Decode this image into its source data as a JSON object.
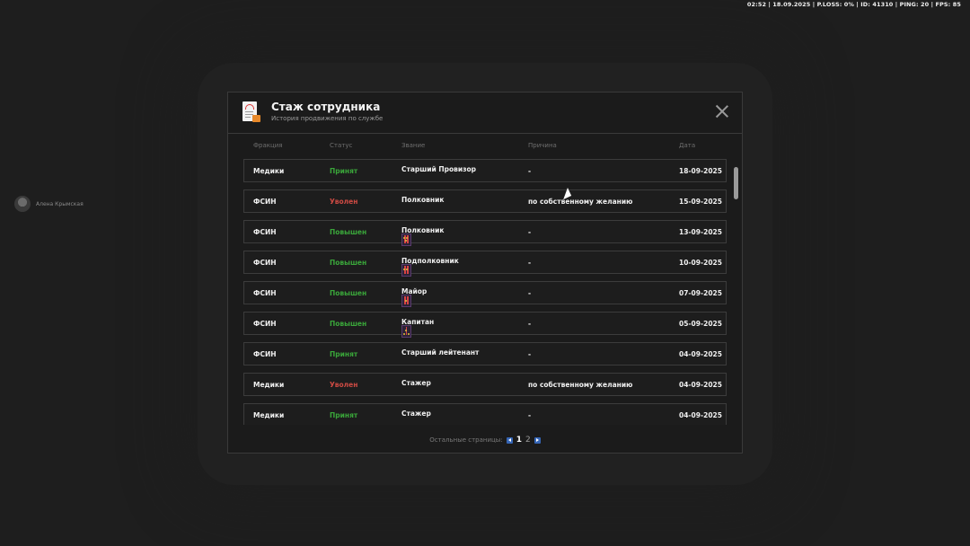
{
  "hud": {
    "text": "02:52 | 18.09.2025 | P.LOSS: 0% | ID: 41310 | PING: 20 | FPS: 85"
  },
  "player": {
    "name": "Алена Крымская"
  },
  "modal": {
    "title": "Стаж сотрудника",
    "subtitle": "История продвижения по службе",
    "columns": {
      "faction": "Фракция",
      "status": "Статус",
      "rank": "Звание",
      "reason": "Причина",
      "date": "Дата"
    },
    "rows": [
      {
        "faction": "Медики",
        "status": "Принят",
        "status_color": "green",
        "rank": "Старший Провизор",
        "rank_icon": "",
        "reason": "-",
        "date": "18-09-2025"
      },
      {
        "faction": "ФСИН",
        "status": "Уволен",
        "status_color": "red",
        "rank": "Полковник",
        "rank_icon": "",
        "reason": "по собственному желанию",
        "date": "15-09-2025"
      },
      {
        "faction": "ФСИН",
        "status": "Повышен",
        "status_color": "green",
        "rank": "Полковник",
        "rank_icon": "colonel-shoulder-strap-icon",
        "reason": "-",
        "date": "13-09-2025"
      },
      {
        "faction": "ФСИН",
        "status": "Повышен",
        "status_color": "green",
        "rank": "Подполковник",
        "rank_icon": "lieutenant-colonel-shoulder-strap-icon",
        "reason": "-",
        "date": "10-09-2025"
      },
      {
        "faction": "ФСИН",
        "status": "Повышен",
        "status_color": "green",
        "rank": "Майор",
        "rank_icon": "major-shoulder-strap-icon",
        "reason": "-",
        "date": "07-09-2025"
      },
      {
        "faction": "ФСИН",
        "status": "Повышен",
        "status_color": "green",
        "rank": "Капитан",
        "rank_icon": "captain-shoulder-strap-icon",
        "reason": "-",
        "date": "05-09-2025"
      },
      {
        "faction": "ФСИН",
        "status": "Принят",
        "status_color": "green",
        "rank": "Старший лейтенант",
        "rank_icon": "",
        "reason": "-",
        "date": "04-09-2025"
      },
      {
        "faction": "Медики",
        "status": "Уволен",
        "status_color": "red",
        "rank": "Стажер",
        "rank_icon": "",
        "reason": "по собственному желанию",
        "date": "04-09-2025"
      },
      {
        "faction": "Медики",
        "status": "Принят",
        "status_color": "green",
        "rank": "Стажер",
        "rank_icon": "",
        "reason": "-",
        "date": "04-09-2025"
      }
    ],
    "pager": {
      "label": "Остальные страницы:",
      "current": "1",
      "next": "2"
    }
  },
  "colors": {
    "green": "#3aa63a",
    "red": "#cc4a43",
    "accent": "#3565b5"
  }
}
